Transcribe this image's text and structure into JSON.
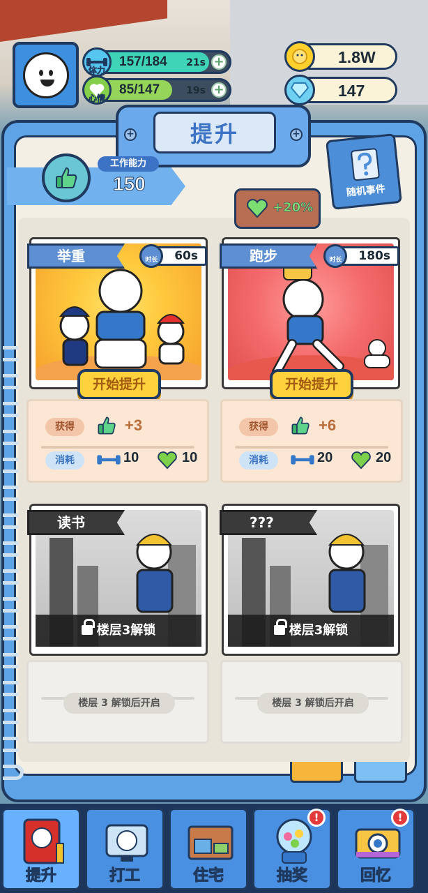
{
  "hud": {
    "stamina": {
      "label": "体力",
      "value": "157/184",
      "timer": "21s",
      "fill": 0.85
    },
    "mood": {
      "label": "心情",
      "value": "85/147",
      "timer": "19s",
      "fill": 0.58
    },
    "coins": "1.8W",
    "gems": "147"
  },
  "page": {
    "title": "提升",
    "ability_label": "工作能力",
    "ability_value": "150",
    "random_event": "随机事件",
    "bonus": "+20%"
  },
  "cards": [
    {
      "title": "举重",
      "time": "60s",
      "time_label": "时长",
      "button": "开始提升",
      "gain_label": "获得",
      "gain": "+3",
      "cost_label": "消耗",
      "cost_stamina": "10",
      "cost_mood": "10"
    },
    {
      "title": "跑步",
      "time": "180s",
      "time_label": "时长",
      "button": "开始提升",
      "gain_label": "获得",
      "gain": "+6",
      "cost_label": "消耗",
      "cost_stamina": "20",
      "cost_mood": "20"
    },
    {
      "title": "读书",
      "lock_text": "楼层3解锁",
      "unlock_hint": "楼层 3 解锁后开启"
    },
    {
      "title": "???",
      "lock_text": "楼层3解锁",
      "unlock_hint": "楼层 3 解锁后开启"
    }
  ],
  "nav": [
    {
      "label": "提升",
      "badge": ""
    },
    {
      "label": "打工",
      "badge": ""
    },
    {
      "label": "住宅",
      "badge": ""
    },
    {
      "label": "抽奖",
      "badge": "!"
    },
    {
      "label": "回忆",
      "badge": "!"
    }
  ],
  "colors": {
    "accent": "#4a90e2",
    "button": "#ffd23d",
    "gain": "#7dde72"
  }
}
